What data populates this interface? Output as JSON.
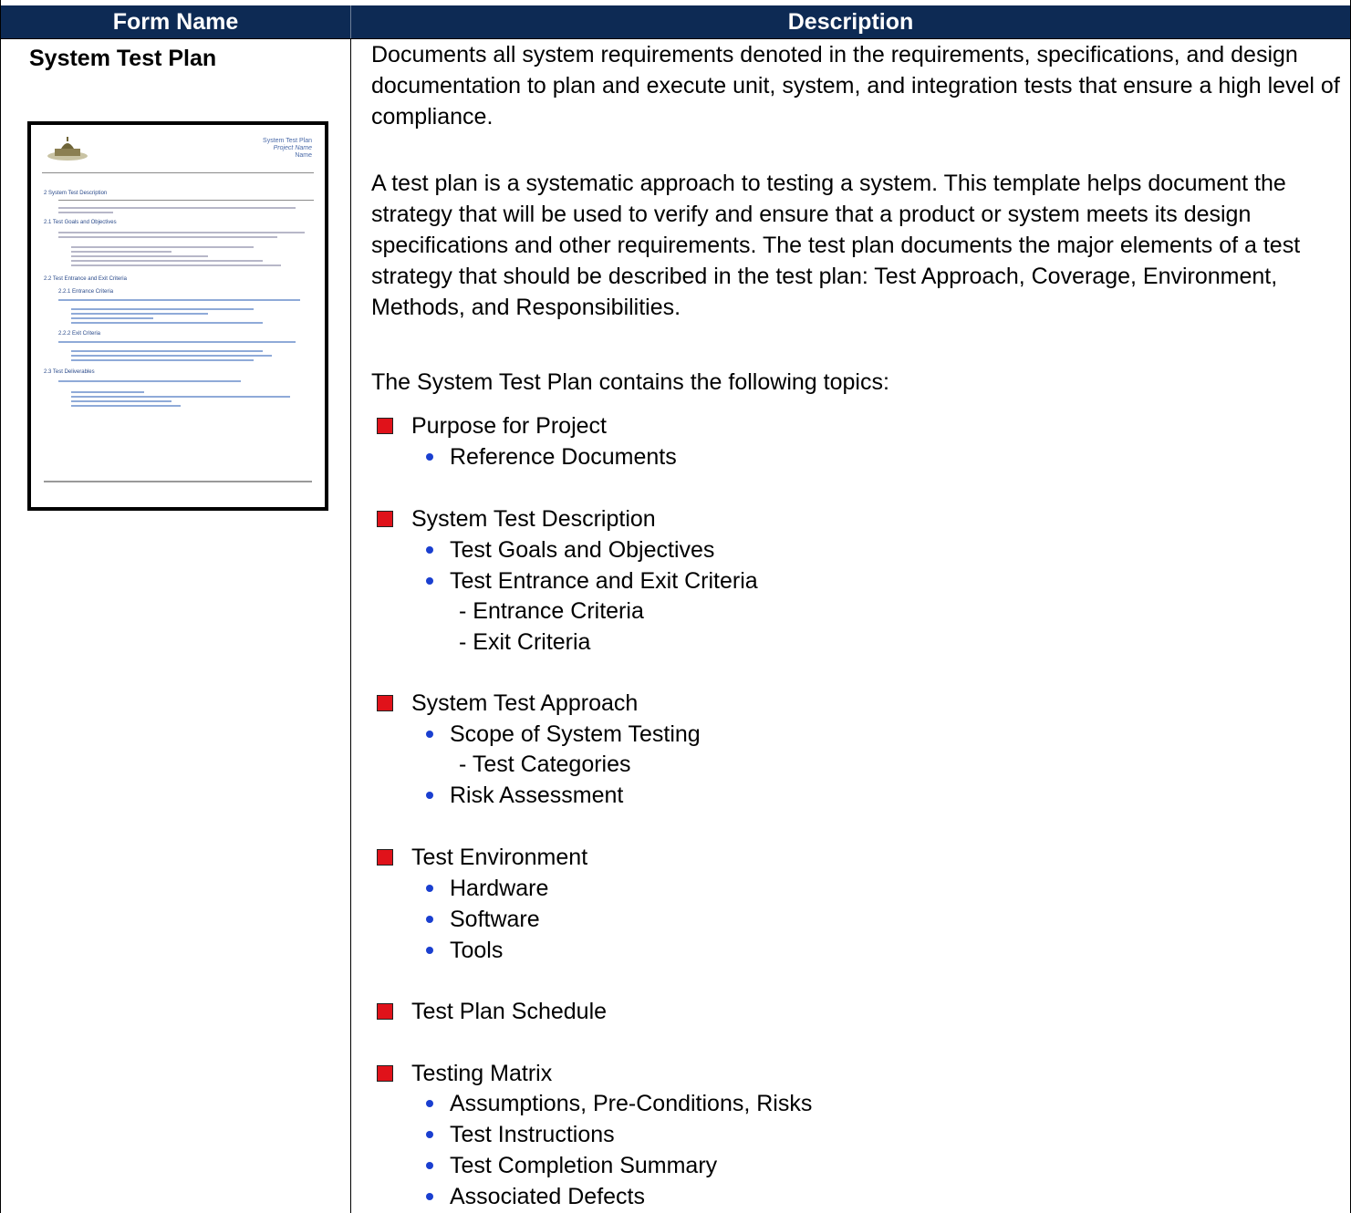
{
  "header": {
    "col1": "Form Name",
    "col2": "Description"
  },
  "form_name": "System Test Plan",
  "thumbnail": {
    "title": "System Test Plan",
    "subtitle": "Project Name",
    "org": "Name",
    "section": "2   System Test Description",
    "h1": "2.1   Test Goals and Objectives",
    "h2": "2.2   Test Entrance and Exit Criteria",
    "h3": "2.2.1   Entrance Criteria",
    "h4": "2.2.2   Exit Criteria",
    "h5": "2.3   Test Deliverables"
  },
  "description": {
    "para1": "Documents all system requirements denoted in the requirements, specifications, and design documentation to plan and execute unit, system, and integration tests that ensure a high level of compliance.",
    "para2": "A test plan is a systematic approach to testing a system. This template helps document the strategy that will be used to verify and ensure that a product or system meets its design specifications and other requirements. The test plan documents the major elements of a test strategy that should be described in the test plan: Test Approach, Coverage, Environment, Methods, and Responsibilities.",
    "para3": "The System Test Plan contains the following topics:"
  },
  "topics": [
    {
      "label": "Purpose for Project",
      "items": [
        "Reference Documents"
      ]
    },
    {
      "label": "System Test Description",
      "items": [
        "Test Goals and Objectives",
        "Test Entrance and Exit Criteria"
      ],
      "subitems": [
        "- Entrance Criteria",
        "- Exit Criteria"
      ]
    },
    {
      "label": "System Test Approach",
      "items": [
        "Scope of System Testing",
        "Risk Assessment"
      ],
      "subitems": [
        "- Test Categories"
      ]
    },
    {
      "label": "Test Environment",
      "items": [
        "Hardware",
        "Software",
        "Tools"
      ]
    },
    {
      "label": "Test Plan Schedule",
      "items": []
    },
    {
      "label": "Testing Matrix",
      "items": [
        "Assumptions, Pre-Conditions, Risks",
        "Test Instructions",
        "Test Completion Summary",
        "Associated Defects"
      ]
    }
  ],
  "colors": {
    "header_bg": "#0d2a54",
    "bullet_square": "#e0121a",
    "bullet_dot": "#1a3fd0"
  }
}
